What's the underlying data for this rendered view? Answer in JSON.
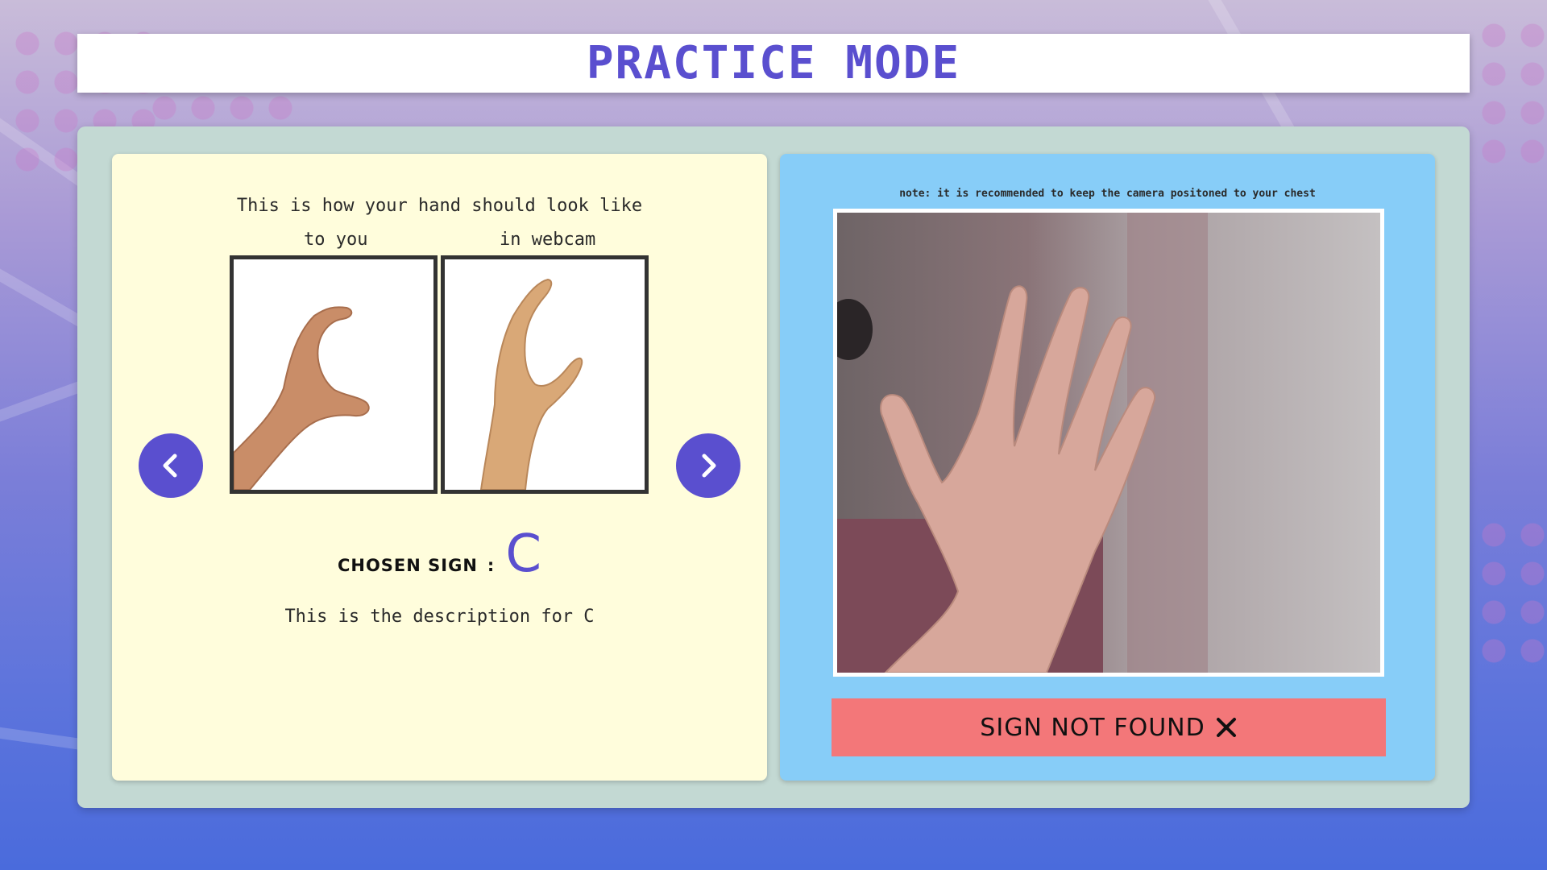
{
  "header": {
    "title": "PRACTICE MODE"
  },
  "reference": {
    "heading": "This is how your hand should look like",
    "label_you": "to you",
    "label_webcam": "in webcam",
    "prev_icon": "chevron-left-icon",
    "next_icon": "chevron-right-icon"
  },
  "sign": {
    "chosen_label": "CHOSEN SIGN",
    "separator": ":",
    "value": "C",
    "description": "This is the description for C"
  },
  "camera": {
    "note": "note: it is recommended to keep the camera positoned to your chest"
  },
  "status": {
    "text": "SIGN NOT FOUND",
    "icon": "close-icon",
    "color": "#f37779"
  },
  "colors": {
    "accent": "#5a4fcf",
    "left_card": "#fffddc",
    "right_card": "#87cdf8",
    "panel": "#c3d9d3"
  }
}
